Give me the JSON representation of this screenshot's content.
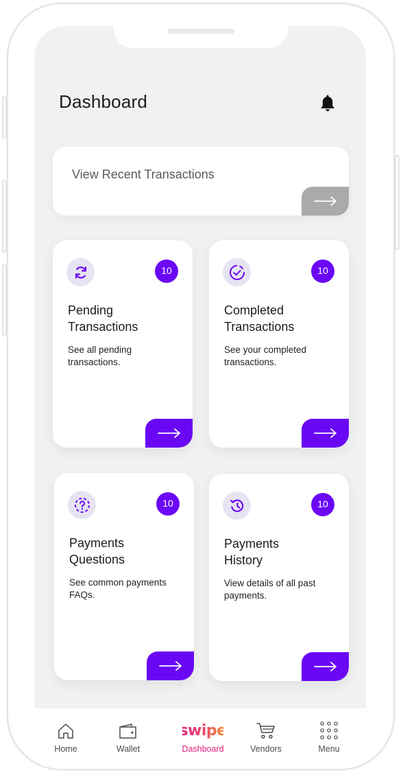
{
  "header": {
    "title": "Dashboard"
  },
  "recent": {
    "label": "View Recent Transactions"
  },
  "cards": [
    {
      "title_line1": "Pending",
      "title_line2": "Transactions",
      "desc_line1": "See all pending",
      "desc_line2": "transactions.",
      "badge": "10",
      "icon": "sync-icon"
    },
    {
      "title_line1": "Completed",
      "title_line2": "Transactions",
      "desc_line1": "See your completed",
      "desc_line2": "transactions.",
      "badge": "10",
      "icon": "check-circle-icon"
    },
    {
      "title_line1": "Payments",
      "title_line2": "Questions",
      "desc_line1": "See common payments",
      "desc_line2": "FAQs.",
      "badge": "10",
      "icon": "question-circle-icon"
    },
    {
      "title_line1": "Payments",
      "title_line2": "History",
      "desc_line1": "View details of all past",
      "desc_line2": "payments.",
      "badge": "10",
      "icon": "history-icon"
    }
  ],
  "nav": {
    "items": [
      {
        "label": "Home",
        "icon": "home-icon"
      },
      {
        "label": "Wallet",
        "icon": "wallet-icon"
      },
      {
        "label": "Dashboard",
        "icon": "swipe-logo",
        "logo_text": "swipe",
        "active": true
      },
      {
        "label": "Vendors",
        "icon": "cart-icon"
      },
      {
        "label": "Menu",
        "icon": "grid-icon"
      }
    ]
  },
  "colors": {
    "accent": "#6a07f5",
    "icon_bg": "#e6e3f2",
    "muted_button": "#aaaaaa",
    "active_nav": "#e0217f",
    "screen_bg": "#f1f1f1"
  }
}
